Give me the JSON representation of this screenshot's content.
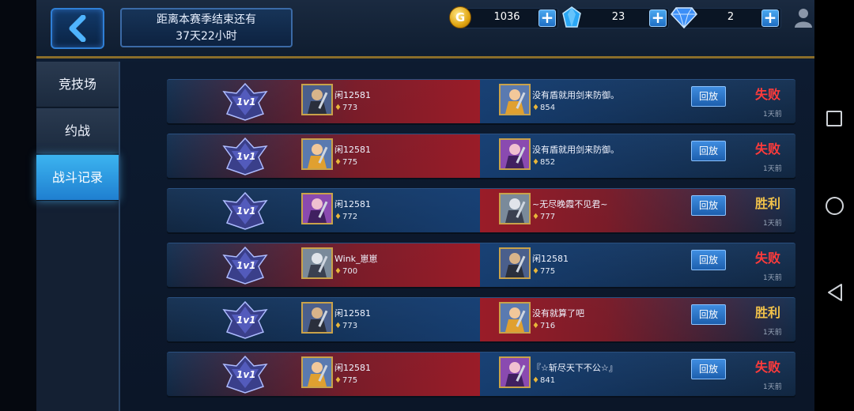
{
  "header": {
    "season_line1": "距离本赛季结束还有",
    "season_line2": "37天22小时",
    "gold": "1036",
    "crystal": "23",
    "diamond": "2",
    "plus": "+"
  },
  "sidebar": {
    "items": [
      {
        "label": "竞技场"
      },
      {
        "label": "约战"
      },
      {
        "label": "战斗记录",
        "active": true
      }
    ]
  },
  "badge_text": "1v1",
  "records": [
    {
      "left_name": "闲12581",
      "left_score": "773",
      "right_name": "没有盾就用剑来防御。",
      "right_score": "854",
      "replay": "回放",
      "result": "失败",
      "time": "1天前"
    },
    {
      "left_name": "闲12581",
      "left_score": "775",
      "right_name": "没有盾就用剑来防御。",
      "right_score": "852",
      "replay": "回放",
      "result": "失败",
      "time": "1天前"
    },
    {
      "left_name": "闲12581",
      "left_score": "772",
      "right_name": "~无尽晚霞不见君~",
      "right_score": "777",
      "replay": "回放",
      "result": "胜利",
      "time": "1天前"
    },
    {
      "left_name": "Wink_崽崽",
      "left_score": "700",
      "right_name": "闲12581",
      "right_score": "775",
      "replay": "回放",
      "result": "失败",
      "time": "1天前"
    },
    {
      "left_name": "闲12581",
      "left_score": "773",
      "right_name": "没有就算了吧",
      "right_score": "716",
      "replay": "回放",
      "result": "胜利",
      "time": "1天前"
    },
    {
      "left_name": "闲12581",
      "left_score": "775",
      "right_name": "『☆斩尽天下不公☆』",
      "right_score": "841",
      "replay": "回放",
      "result": "失败",
      "time": "1天前"
    }
  ],
  "colors": {
    "lose": "#ff3b3b",
    "win": "#f1c24a",
    "accent": "#2f7fd6"
  },
  "icons": [
    "back-arrow-icon",
    "gold-coin-icon",
    "crystal-icon",
    "diamond-icon",
    "profile-icon",
    "settings-icon",
    "trophy-icon",
    "recents-icon",
    "home-icon",
    "back-icon"
  ]
}
